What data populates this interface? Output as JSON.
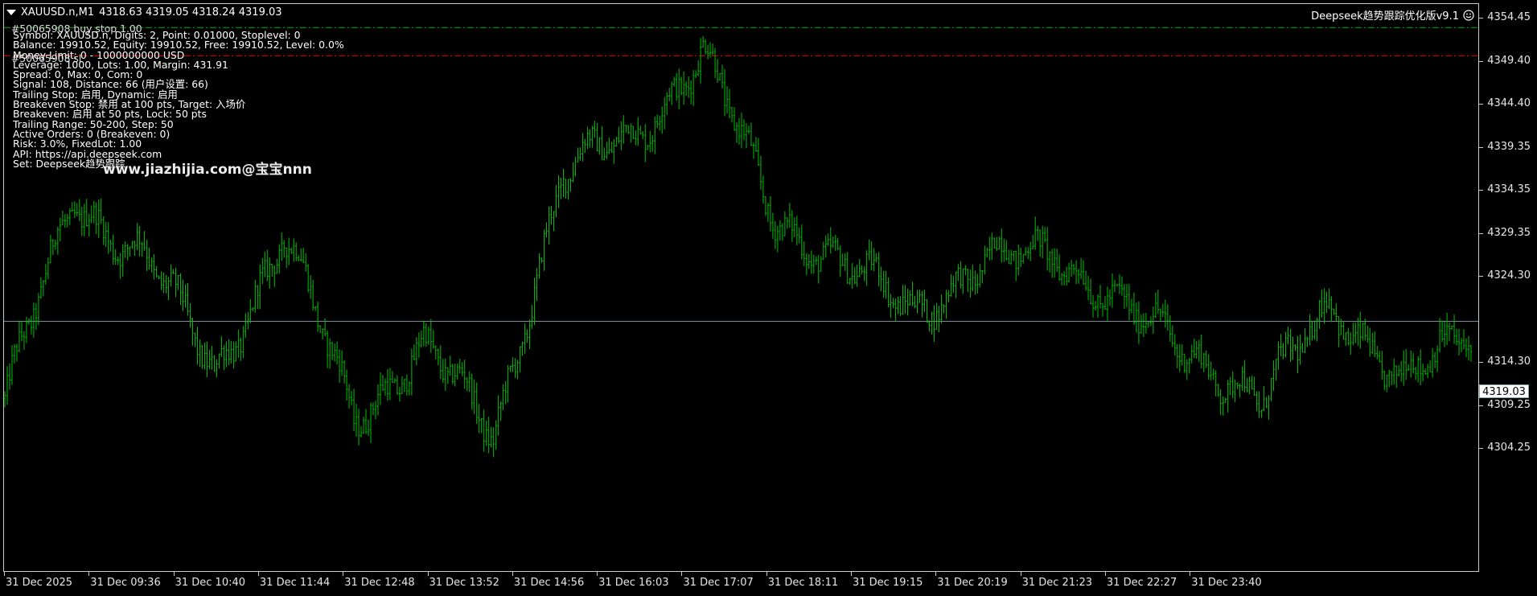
{
  "header": {
    "symbol_timeframe": "XAUUSD.n,M1",
    "ohlc": "4318.63 4319.05 4318.24 4319.03"
  },
  "ea": {
    "name": "Deepseek趋势跟踪优化版v9.1",
    "icon": "smiley-face-icon"
  },
  "info_panel": {
    "lines": [
      "Symbol: XAUUSD.n, Digits: 2, Point: 0.01000, Stoplevel: 0",
      "Balance: 19910.52, Equity: 19910.52, Free: 19910.52, Level: 0.0%",
      "Money Limit: 0 - 1000000000 USD",
      "Leverage: 1000, Lots: 1.00, Margin: 431.91",
      "Spread: 0, Max: 0, Com: 0",
      "Signal: 108, Distance: 66 (用户设置: 66)",
      "Trailing Stop: 启用, Dynamic: 启用",
      "Breakeven Stop: 禁用 at 100 pts, Target: 入场价",
      "Breakeven: 启用 at 50 pts, Lock: 50 pts",
      "Trailing Range: 50-200, Step: 50",
      "Active Orders: 0 (Breakeven: 0)",
      "Risk: 3.0%, FixedLot: 1.00",
      "API: https://api.deepseek.com",
      "Set: Deepseek趋势跟踪"
    ],
    "overlay_line_1": "#50065908 buy stop 1.00",
    "overlay_line_2": "#50065908 sl"
  },
  "watermark": "www.jiazhijia.com@宝宝nnn",
  "price_axis": {
    "labels": [
      "4354.45",
      "4349.40",
      "4344.40",
      "4339.35",
      "4334.35",
      "4329.35",
      "4324.30",
      "4314.30",
      "4309.25",
      "4304.25"
    ],
    "current_price": "4319.03"
  },
  "time_axis": {
    "labels": [
      "31 Dec 2025",
      "31 Dec 09:36",
      "31 Dec 10:40",
      "31 Dec 11:44",
      "31 Dec 12:48",
      "31 Dec 13:52",
      "31 Dec 14:56",
      "31 Dec 16:03",
      "31 Dec 17:07",
      "31 Dec 18:11",
      "31 Dec 19:15",
      "31 Dec 20:19",
      "31 Dec 21:23",
      "31 Dec 22:27",
      "31 Dec 23:40"
    ]
  },
  "levels": {
    "buy_stop_price": 4353.3,
    "stop_loss_price": 4350.0,
    "current_price": 4319.03
  },
  "colors": {
    "background": "#000000",
    "candles": "#00c000",
    "buy_stop_line": "#00b000",
    "stop_loss_line": "#e00000",
    "current_price_line": "#778899",
    "text": "#ffffff"
  },
  "chart_data": {
    "type": "line",
    "title": "",
    "xlabel": "",
    "ylabel": "",
    "ylim": [
      4302.5,
      4357.0
    ],
    "x": [
      "31 Dec 2025",
      "31 Dec 09:36",
      "31 Dec 10:40",
      "31 Dec 11:44",
      "31 Dec 12:48",
      "31 Dec 13:52",
      "31 Dec 14:56",
      "31 Dec 16:03",
      "31 Dec 17:07",
      "31 Dec 18:11",
      "31 Dec 19:15",
      "31 Dec 20:19",
      "31 Dec 21:23",
      "31 Dec 22:27",
      "31 Dec 23:40"
    ],
    "series": [
      {
        "values": [
          4310.0,
          4333.0,
          4327.0,
          4313.0,
          4329.0,
          4308.0,
          4316.0,
          4306.0,
          4336.0,
          4341.0,
          4350.0,
          4332.0,
          4325.0,
          4321.0,
          4325.0,
          4328.0,
          4320.0,
          4316.0,
          4309.0,
          4322.0,
          4311.0,
          4319.0
        ]
      }
    ]
  }
}
